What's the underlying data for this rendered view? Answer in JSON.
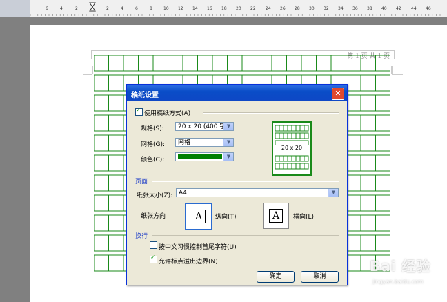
{
  "ruler": {
    "numbers": [
      "6",
      "4",
      "2",
      "2",
      "4",
      "6",
      "8",
      "10",
      "12",
      "14",
      "16",
      "18",
      "20",
      "22",
      "24",
      "26",
      "28",
      "30",
      "32",
      "34",
      "36",
      "38",
      "40",
      "42",
      "44",
      "46"
    ]
  },
  "page": {
    "header_text": "第 1 页 共 1 页"
  },
  "dialog": {
    "title": "稿纸设置",
    "close_glyph": "✕",
    "use_grid_label": "使用稿纸方式(A)",
    "use_grid_checked": true,
    "spec_label": "规格(S):",
    "spec_value": "20 x 20 (400 字)",
    "grid_label": "网格(G):",
    "grid_value": "网格",
    "color_label": "颜色(C):",
    "color_value": "#008000",
    "preview_label": "20 x 20",
    "page_section": "页面",
    "paper_size_label": "纸张大小(Z):",
    "paper_size_value": "A4",
    "orientation_label": "纸张方向",
    "portrait_label": "纵向(T)",
    "landscape_label": "横向(L)",
    "orientation_icon": "A",
    "wrap_section": "换行",
    "wrap_opt1_label": "按中文习惯控制首尾字符(U)",
    "wrap_opt1_checked": false,
    "wrap_opt2_label": "允许标点溢出边界(N)",
    "wrap_opt2_checked": true,
    "ok_label": "确定",
    "cancel_label": "取消"
  },
  "watermark": {
    "text": "Bai 经验",
    "sub": "jingyan.baidu.com"
  },
  "colors": {
    "grid_green": "#1a8a1a",
    "title_blue": "#0a4dc7",
    "dialog_bg": "#ece9d8"
  }
}
